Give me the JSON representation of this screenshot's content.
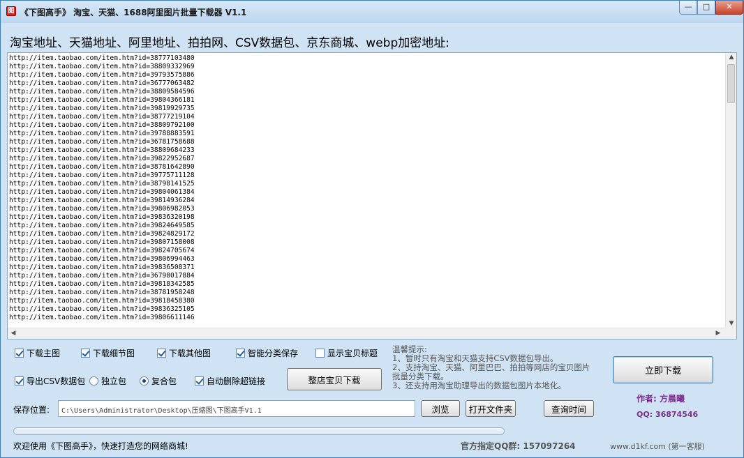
{
  "window": {
    "icon_glyph": "图",
    "title": "《下图高手》 淘宝、天猫、1688阿里图片批量下载器 V1.1",
    "min_glyph": "—",
    "max_glyph": "□",
    "close_glyph": "✕"
  },
  "main": {
    "section_label": "淘宝地址、天猫地址、阿里地址、拍拍网、CSV数据包、京东商城、webp加密地址:",
    "urls": [
      "http://item.taobao.com/item.htm?id=38777103480",
      "http://item.taobao.com/item.htm?id=38809332969",
      "http://item.taobao.com/item.htm?id=39793575886",
      "http://item.taobao.com/item.htm?id=36777063482",
      "http://item.taobao.com/item.htm?id=38809584596",
      "http://item.taobao.com/item.htm?id=39804366181",
      "http://item.taobao.com/item.htm?id=39819929735",
      "http://item.taobao.com/item.htm?id=38777219104",
      "http://item.taobao.com/item.htm?id=38809792100",
      "http://item.taobao.com/item.htm?id=39788883591",
      "http://item.taobao.com/item.htm?id=36781758688",
      "http://item.taobao.com/item.htm?id=38809684233",
      "http://item.taobao.com/item.htm?id=39822952687",
      "http://item.taobao.com/item.htm?id=38781642890",
      "http://item.taobao.com/item.htm?id=39775711128",
      "http://item.taobao.com/item.htm?id=38798141525",
      "http://item.taobao.com/item.htm?id=39804061384",
      "http://item.taobao.com/item.htm?id=39814936284",
      "http://item.taobao.com/item.htm?id=39806982053",
      "http://item.taobao.com/item.htm?id=39836320198",
      "http://item.taobao.com/item.htm?id=39824649585",
      "http://item.taobao.com/item.htm?id=39824829172",
      "http://item.taobao.com/item.htm?id=39807158008",
      "http://item.taobao.com/item.htm?id=39824705674",
      "http://item.taobao.com/item.htm?id=39806994463",
      "http://item.taobao.com/item.htm?id=39836508371",
      "http://item.taobao.com/item.htm?id=36798017884",
      "http://item.taobao.com/item.htm?id=39818342585",
      "http://item.taobao.com/item.htm?id=38781958248",
      "http://item.taobao.com/item.htm?id=39818458380",
      "http://item.taobao.com/item.htm?id=39836325105",
      "http://item.taobao.com/item.htm?id=39806611146"
    ]
  },
  "options": {
    "download_main": {
      "label": "下载主图",
      "checked": true
    },
    "download_detail": {
      "label": "下载细节图",
      "checked": true
    },
    "download_other": {
      "label": "下载其他图",
      "checked": true
    },
    "smart_sort": {
      "label": "智能分类保存",
      "checked": true
    },
    "show_title": {
      "label": "显示宝贝标题",
      "checked": false
    },
    "export_csv": {
      "label": "导出CSV数据包",
      "checked": true
    },
    "radio_single": {
      "label": "独立包",
      "selected": false
    },
    "radio_combined": {
      "label": "复合包",
      "selected": true
    },
    "auto_delete": {
      "label": "自动删除超链接",
      "checked": true
    }
  },
  "tips": {
    "heading": "温馨提示:",
    "lines": [
      "1、暂时只有淘宝和天猫支持CSV数据包导出。",
      "2、支持淘宝、天猫、阿里巴巴、拍拍等网店的宝贝图片",
      "批量分类下载。",
      "3、还支持用淘宝助理导出的数据包图片本地化。"
    ]
  },
  "buttons": {
    "whole_shop": "整店宝贝下载",
    "download_now": "立即下载",
    "browse": "浏览",
    "open_folder": "打开文件夹",
    "query_time": "查询时间"
  },
  "save": {
    "label": "保存位置:",
    "path": "C:\\Users\\Administrator\\Desktop\\压缩图\\下图高手V1.1"
  },
  "author": {
    "name": "作者: 方晨曦",
    "qq": "QQ: 36874546"
  },
  "progress": {
    "value": 0
  },
  "footer": {
    "welcome": "欢迎使用《下图高手》，快速打造您的网络商城!",
    "qq_group": "官方指定QQ群: 157097264",
    "site": "www.d1kf.com (第一客服)"
  },
  "scrollbar": {
    "up": "▲",
    "down": "▼",
    "left": "◀",
    "right": "▶"
  }
}
